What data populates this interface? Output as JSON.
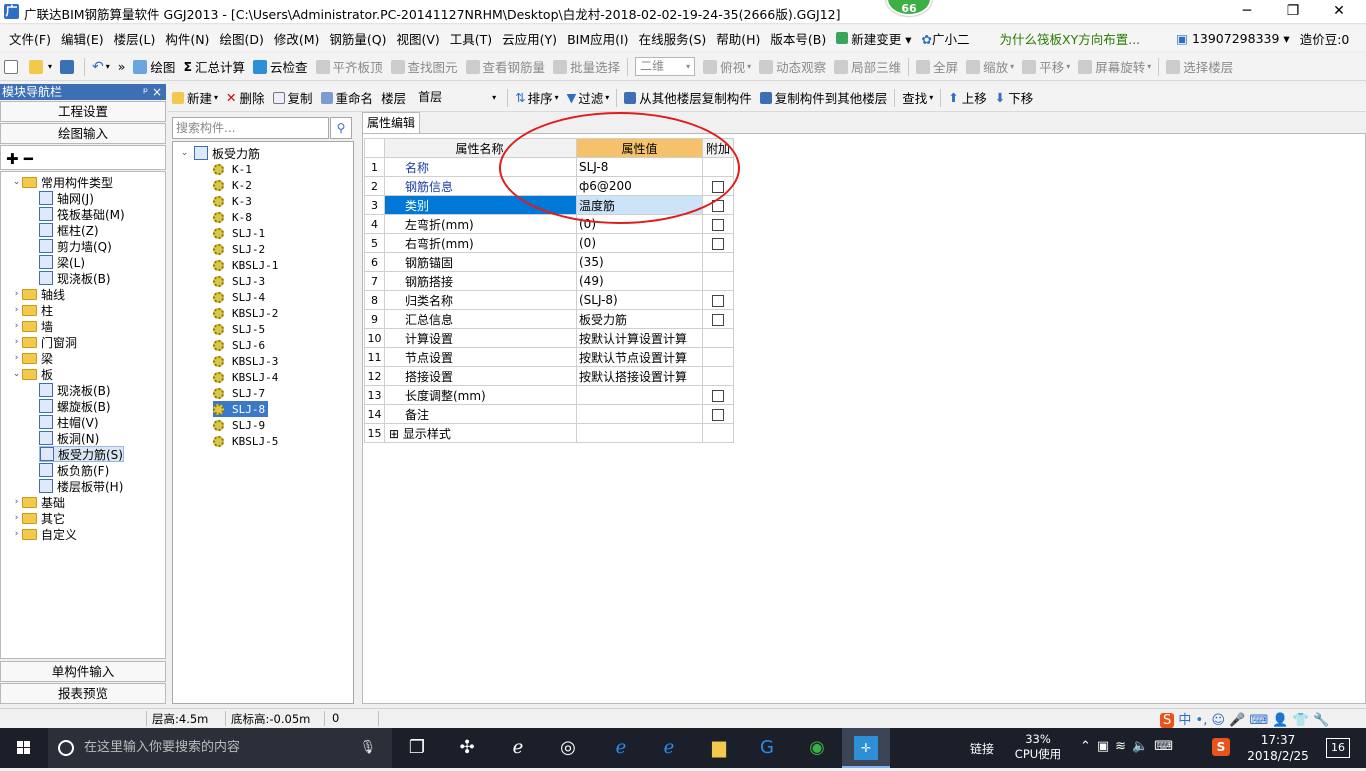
{
  "window": {
    "title": "广联达BIM钢筋算量软件 GGJ2013 - [C:\\Users\\Administrator.PC-20141127NRHM\\Desktop\\白龙村-2018-02-02-19-24-35(2666版).GGJ12]",
    "badge": "66",
    "app_icon": "广",
    "min": "─",
    "max": "❐",
    "close": "✕"
  },
  "menu": [
    "文件(F)",
    "编辑(E)",
    "楼层(L)",
    "构件(N)",
    "绘图(D)",
    "修改(M)",
    "钢筋量(Q)",
    "视图(V)",
    "工具(T)",
    "云应用(Y)",
    "BIM应用(I)",
    "在线服务(S)",
    "帮助(H)",
    "版本号(B)"
  ],
  "menu_extra": {
    "new_change": "新建变更",
    "assistant": "广小二",
    "ad": "为什么筏板XY方向布置...",
    "phone": "13907298339",
    "coin": "造价豆:0"
  },
  "toolbar1": {
    "draw": "绘图",
    "sum": "汇总计算",
    "cloud_check": "云检查",
    "level_top": "平齐板顶",
    "find_elem": "查找图元",
    "view_rebar": "查看钢筋量",
    "batch_select": "批量选择",
    "view_mode": "二维",
    "top_view": "俯视",
    "dynamic": "动态观察",
    "local3d": "局部三维",
    "fullscreen": "全屏",
    "zoom": "缩放",
    "pan": "平移",
    "rotate": "屏幕旋转",
    "select_floor": "选择楼层"
  },
  "toolbar2": {
    "new": "新建",
    "delete": "删除",
    "copy": "复制",
    "rename": "重命名",
    "floor_label": "楼层",
    "floor_value": "首层",
    "sort": "排序",
    "filter": "过滤",
    "copy_from": "从其他楼层复制构件",
    "copy_to": "复制构件到其他楼层",
    "find": "查找",
    "move_up": "上移",
    "move_down": "下移"
  },
  "nav": {
    "header": "模块导航栏",
    "pin": "ᵖ ×",
    "project_settings": "工程设置",
    "drawing_input": "绘图输入",
    "single_input": "单构件输入",
    "report_preview": "报表预览"
  },
  "nav_tree": [
    {
      "label": "常用构件类型",
      "level": 0,
      "type": "folder",
      "exp": "⌄"
    },
    {
      "label": "轴网(J)",
      "level": 1,
      "type": "comp"
    },
    {
      "label": "筏板基础(M)",
      "level": 1,
      "type": "comp"
    },
    {
      "label": "框柱(Z)",
      "level": 1,
      "type": "comp"
    },
    {
      "label": "剪力墙(Q)",
      "level": 1,
      "type": "comp"
    },
    {
      "label": "梁(L)",
      "level": 1,
      "type": "comp"
    },
    {
      "label": "现浇板(B)",
      "level": 1,
      "type": "comp"
    },
    {
      "label": "轴线",
      "level": 0,
      "type": "folder",
      "exp": "›"
    },
    {
      "label": "柱",
      "level": 0,
      "type": "folder",
      "exp": "›"
    },
    {
      "label": "墙",
      "level": 0,
      "type": "folder",
      "exp": "›"
    },
    {
      "label": "门窗洞",
      "level": 0,
      "type": "folder",
      "exp": "›"
    },
    {
      "label": "梁",
      "level": 0,
      "type": "folder",
      "exp": "›"
    },
    {
      "label": "板",
      "level": 0,
      "type": "folder",
      "exp": "⌄"
    },
    {
      "label": "现浇板(B)",
      "level": 1,
      "type": "comp"
    },
    {
      "label": "螺旋板(B)",
      "level": 1,
      "type": "comp"
    },
    {
      "label": "柱帽(V)",
      "level": 1,
      "type": "comp"
    },
    {
      "label": "板洞(N)",
      "level": 1,
      "type": "comp"
    },
    {
      "label": "板受力筋(S)",
      "level": 1,
      "type": "comp",
      "selected": true
    },
    {
      "label": "板负筋(F)",
      "level": 1,
      "type": "comp"
    },
    {
      "label": "楼层板带(H)",
      "level": 1,
      "type": "comp"
    },
    {
      "label": "基础",
      "level": 0,
      "type": "folder",
      "exp": "›"
    },
    {
      "label": "其它",
      "level": 0,
      "type": "folder",
      "exp": "›"
    },
    {
      "label": "自定义",
      "level": 0,
      "type": "folder",
      "exp": "›"
    }
  ],
  "search": {
    "placeholder": "搜索构件..."
  },
  "comp_root": "板受力筋",
  "components": [
    "K-1",
    "K-2",
    "K-3",
    "K-8",
    "SLJ-1",
    "SLJ-2",
    "KBSLJ-1",
    "SLJ-3",
    "SLJ-4",
    "KBSLJ-2",
    "SLJ-5",
    "SLJ-6",
    "KBSLJ-3",
    "KBSLJ-4",
    "SLJ-7",
    "SLJ-8",
    "SLJ-9",
    "KBSLJ-5"
  ],
  "selected_component": "SLJ-8",
  "prop_tab": "属性编辑",
  "prop_headers": {
    "name": "属性名称",
    "value": "属性值",
    "extra": "附加"
  },
  "props": [
    {
      "no": "1",
      "name": "名称",
      "value": "SLJ-8",
      "blue": true,
      "check": false
    },
    {
      "no": "2",
      "name": "钢筋信息",
      "value": "ф6@200",
      "blue": true,
      "check": true
    },
    {
      "no": "3",
      "name": "类别",
      "value": "温度筋",
      "blue": true,
      "check": true,
      "selected": true
    },
    {
      "no": "4",
      "name": "左弯折(mm)",
      "value": "(0)",
      "check": true
    },
    {
      "no": "5",
      "name": "右弯折(mm)",
      "value": "(0)",
      "check": true
    },
    {
      "no": "6",
      "name": "钢筋锚固",
      "value": "(35)",
      "check": false
    },
    {
      "no": "7",
      "name": "钢筋搭接",
      "value": "(49)",
      "check": false
    },
    {
      "no": "8",
      "name": "归类名称",
      "value": "(SLJ-8)",
      "check": true
    },
    {
      "no": "9",
      "name": "汇总信息",
      "value": "板受力筋",
      "check": true
    },
    {
      "no": "10",
      "name": "计算设置",
      "value": "按默认计算设置计算",
      "check": false
    },
    {
      "no": "11",
      "name": "节点设置",
      "value": "按默认节点设置计算",
      "check": false
    },
    {
      "no": "12",
      "name": "搭接设置",
      "value": "按默认搭接设置计算",
      "check": false
    },
    {
      "no": "13",
      "name": "长度调整(mm)",
      "value": "",
      "check": true
    },
    {
      "no": "14",
      "name": "备注",
      "value": "",
      "check": true
    },
    {
      "no": "15",
      "name": "显示样式",
      "value": "",
      "check": false,
      "expand": true
    }
  ],
  "status": {
    "floor_height": "层高:4.5m",
    "base_height": "底标高:-0.05m",
    "count": "0"
  },
  "taskbar": {
    "search_placeholder": "在这里输入你要搜索的内容",
    "link": "链接",
    "cpu_pct": "33%",
    "cpu_label": "CPU使用",
    "time": "17:37",
    "date": "2018/2/25",
    "notif": "16",
    "ime": "中"
  },
  "colors": {
    "header_blue": "#3c6fb4",
    "highlight_orange": "#f5c26b",
    "selection_blue": "#0078d7",
    "annotation_red": "#e21b1b"
  }
}
